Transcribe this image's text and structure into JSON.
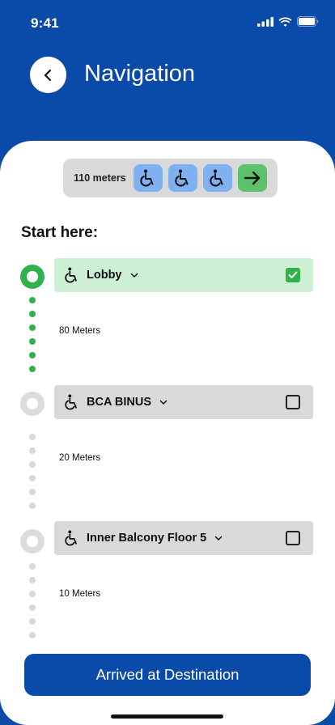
{
  "status_bar": {
    "time": "9:41"
  },
  "header": {
    "title": "Navigation"
  },
  "summary": {
    "distance": "110 meters",
    "chips": [
      "wheelchair-icon",
      "wheelchair-icon",
      "wheelchair-icon",
      "arrow-right-icon"
    ],
    "colors": {
      "chip": "#7fb0f0",
      "go": "#5cc16b"
    }
  },
  "route": {
    "start_label": "Start here:",
    "steps": [
      {
        "name": "Lobby",
        "checked": true,
        "leg_distance": "80 Meters"
      },
      {
        "name": "BCA BINUS",
        "checked": false,
        "leg_distance": "20 Meters"
      },
      {
        "name": "Inner Balcony Floor 5",
        "checked": false,
        "leg_distance": "10 Meters"
      }
    ]
  },
  "cta": {
    "label": "Arrived at Destination"
  },
  "colors": {
    "brand": "#0a4aa8",
    "success": "#2fb24c",
    "done_card": "#cdf0d5"
  }
}
